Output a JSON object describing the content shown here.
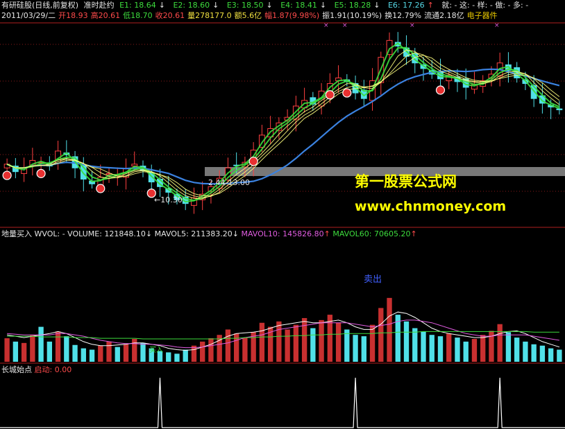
{
  "header": {
    "stock": "有研硅股(日线,前复权)",
    "indicator": "准时赴约",
    "e_lines": [
      {
        "label": "E1: 18.64",
        "arrow": "↓",
        "dir": "down"
      },
      {
        "label": "E2: 18.60",
        "arrow": "↓",
        "dir": "down"
      },
      {
        "label": "E3: 18.50",
        "arrow": "↓",
        "dir": "down"
      },
      {
        "label": "E4: 18.41",
        "arrow": "↓",
        "dir": "down"
      },
      {
        "label": "E5: 18.28",
        "arrow": "↓",
        "dir": "down"
      },
      {
        "label": "E6: 17.26",
        "arrow": "↑",
        "dir": "up"
      }
    ],
    "flags": "就: - 这: - 样: - 做: - 多: -",
    "quote": {
      "date": "2011/03/29/二",
      "open": "开18.93",
      "high": "高20.61",
      "low": "低18.70",
      "close": "收20.61",
      "volume": "量278177.0",
      "amount": "额5.6亿",
      "change": "幅1.87(9.98%)",
      "amplitude": "振1.91(10.19%)",
      "turnover": "换12.79%",
      "float": "流通2.18亿",
      "sector": "电子器件"
    }
  },
  "annotations": {
    "low_label": "←10.30",
    "range_label": "2.44-13.00",
    "sell_label": "卖出",
    "buy_label": "买入"
  },
  "watermark": {
    "line1": "第一股票公式网",
    "line2": "www.chnmoney.com"
  },
  "volume_pane": {
    "title": "地量买入",
    "wvol": "WVOL: -",
    "volume": "VOLUME: 121848.10",
    "volume_arrow": "↓",
    "mavol5": "MAVOL5: 211383.20",
    "mavol5_arrow": "↓",
    "mavol10": "MAVOL10: 145826.80",
    "mavol10_arrow": "↑",
    "mavol60": "MAVOL60: 70605.20",
    "mavol60_arrow": "↑"
  },
  "signal_pane": {
    "title": "长城始点",
    "label": "启动:",
    "value": "0.00"
  },
  "colors": {
    "up": "#ff4040",
    "down": "#50e0e8",
    "ma_long": "#3b82e0",
    "ribbon_green": "#3ddc3d",
    "ribbon_yellow": "#ffff80",
    "gray_band": "#a0a0a0",
    "mavol5": "#ffffff",
    "mavol10": "#e05ce0",
    "mavol60": "#3ddc3d",
    "grid": "#8b1a1a"
  },
  "chart_data": {
    "type": "candlestick",
    "close_series": [
      21.0,
      20.2,
      20.6,
      21.4,
      21.2,
      20.8,
      22.4,
      22.0,
      20.6,
      19.4,
      18.9,
      19.6,
      20.0,
      19.8,
      20.5,
      21.0,
      20.3,
      19.1,
      18.6,
      18.0,
      17.2,
      16.8,
      17.4,
      17.8,
      18.6,
      19.5,
      20.6,
      20.9,
      21.2,
      22.5,
      24.1,
      24.8,
      25.4,
      26.0,
      27.2,
      27.8,
      27.4,
      28.8,
      29.6,
      30.2,
      29.8,
      28.6,
      28.0,
      29.9,
      32.4,
      34.2,
      33.6,
      32.5,
      31.8,
      31.2,
      30.6,
      30.1,
      30.5,
      29.8,
      29.2,
      29.5,
      29.9,
      30.6,
      31.8,
      31.0,
      30.2,
      29.6,
      28.0,
      27.5,
      27.1,
      26.8
    ],
    "volume_series": [
      35,
      30,
      28,
      40,
      52,
      30,
      45,
      38,
      25,
      20,
      18,
      24,
      30,
      22,
      26,
      34,
      28,
      20,
      16,
      14,
      12,
      18,
      24,
      30,
      35,
      40,
      48,
      42,
      36,
      44,
      58,
      52,
      60,
      48,
      55,
      65,
      50,
      62,
      70,
      58,
      48,
      40,
      38,
      55,
      80,
      95,
      70,
      60,
      50,
      45,
      40,
      38,
      42,
      36,
      30,
      34,
      40,
      46,
      56,
      44,
      36,
      30,
      26,
      24,
      20,
      18
    ],
    "mavol5_series": [
      40,
      38,
      36,
      38,
      40,
      42,
      45,
      42,
      36,
      30,
      26,
      24,
      24,
      25,
      26,
      28,
      28,
      26,
      24,
      20,
      18,
      17,
      18,
      22,
      26,
      32,
      38,
      42,
      43,
      44,
      46,
      50,
      54,
      56,
      58,
      60,
      58,
      58,
      60,
      62,
      58,
      52,
      48,
      48,
      56,
      68,
      74,
      72,
      66,
      58,
      50,
      45,
      42,
      40,
      38,
      36,
      36,
      38,
      42,
      45,
      46,
      42,
      36,
      30,
      26,
      22
    ],
    "mavol10_series": [
      42,
      41,
      40,
      40,
      40,
      40,
      42,
      42,
      40,
      38,
      35,
      32,
      30,
      28,
      27,
      27,
      26,
      26,
      25,
      24,
      22,
      21,
      21,
      22,
      24,
      26,
      28,
      32,
      36,
      38,
      40,
      44,
      48,
      50,
      52,
      54,
      56,
      58,
      58,
      58,
      58,
      56,
      54,
      52,
      54,
      56,
      60,
      62,
      62,
      60,
      58,
      54,
      50,
      46,
      42,
      40,
      38,
      38,
      40,
      40,
      40,
      40,
      38,
      36,
      34,
      32
    ],
    "mavol60_series": [
      38,
      38,
      38,
      38,
      37,
      37,
      37,
      37,
      36,
      36,
      36,
      35,
      35,
      35,
      35,
      35,
      34,
      34,
      34,
      34,
      34,
      34,
      34,
      34,
      34,
      34,
      35,
      35,
      36,
      36,
      37,
      37,
      38,
      38,
      39,
      39,
      40,
      40,
      41,
      41,
      42,
      42,
      42,
      42,
      43,
      43,
      44,
      44,
      44,
      45,
      45,
      45,
      45,
      45,
      45,
      45,
      45,
      45,
      45,
      45,
      45,
      45,
      44,
      44,
      44,
      44
    ],
    "signal_peaks": [
      18,
      41,
      58
    ],
    "buy_markers": [
      0,
      4,
      11,
      17,
      29,
      38,
      40,
      51
    ],
    "ylim_price": [
      15,
      36
    ],
    "ylim_volume": [
      0,
      100
    ]
  }
}
